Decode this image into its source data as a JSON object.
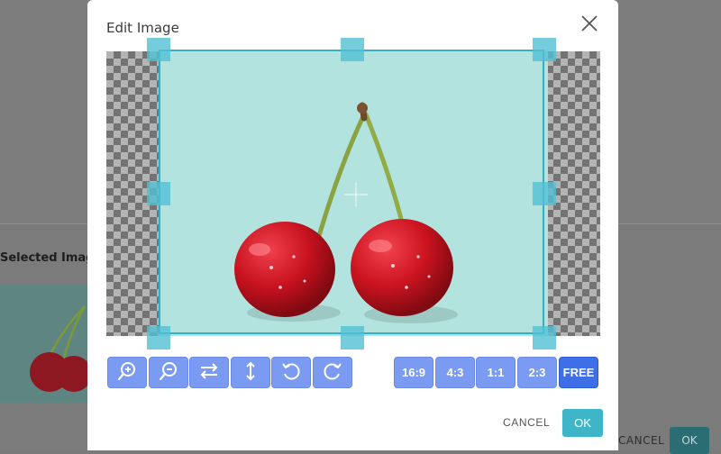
{
  "background": {
    "section_title": "Selected Image",
    "cancel_label": "CANCEL",
    "ok_label": "OK"
  },
  "modal": {
    "title": "Edit Image",
    "close_icon": "close-icon",
    "toolbar": {
      "tools": [
        {
          "name": "zoom-in-icon"
        },
        {
          "name": "zoom-out-icon"
        },
        {
          "name": "flip-horizontal-icon"
        },
        {
          "name": "flip-vertical-icon"
        },
        {
          "name": "rotate-left-icon"
        },
        {
          "name": "rotate-right-icon"
        }
      ],
      "ratios": [
        "16:9",
        "4:3",
        "1:1",
        "2:3",
        "FREE"
      ],
      "selected_ratio": "FREE"
    },
    "cancel_label": "CANCEL",
    "ok_label": "OK"
  },
  "colors": {
    "accent": "#3fb6c8",
    "tool_button": "#7b9bf3",
    "tool_button_active": "#3f6fe6",
    "crop_border": "#36b0c6"
  }
}
